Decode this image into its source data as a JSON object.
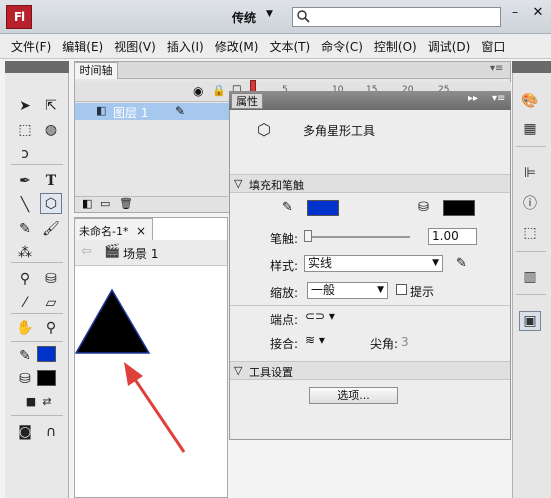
{
  "app": {
    "logo_text": "Fl",
    "workspace": "传统",
    "workspace_caret": "▼",
    "search_placeholder": "",
    "min_symbol": "–",
    "close_symbol": "✕"
  },
  "menu": [
    "文件(F)",
    "编辑(E)",
    "视图(V)",
    "插入(I)",
    "修改(M)",
    "文本(T)",
    "命令(C)",
    "控制(O)",
    "调试(D)",
    "窗口"
  ],
  "timeline": {
    "tab": "时间轴",
    "layer": "图层 1",
    "frame_numbers": [
      "5",
      "10",
      "15",
      "20",
      "25"
    ]
  },
  "document": {
    "tab": "未命名-1*",
    "tab_close": "×",
    "scene": "场景 1",
    "triangle_fill": "#000000",
    "triangle_stroke": "#1e3aa0",
    "arrow_color": "#e0403a"
  },
  "properties": {
    "tab": "属性",
    "tool_name": "多角星形工具",
    "section_fill_stroke": "填充和笔触",
    "stroke_color": "#0033cc",
    "fill_color": "#000000",
    "stroke_label": "笔触:",
    "stroke_value": "1.00",
    "style_label": "样式:",
    "style_value": "实线",
    "scale_label": "缩放:",
    "scale_value": "一般",
    "hint_label": "提示",
    "cap_label": "端点:",
    "join_label": "接合:",
    "miter_label": "尖角:",
    "miter_value": "3",
    "section_tool_settings": "工具设置",
    "options_button": "选项..."
  },
  "colors": {
    "stroke_swatch_tools": "#0033cc",
    "fill_swatch_tools": "#000000",
    "selected_layer": "#a6c7ee"
  }
}
